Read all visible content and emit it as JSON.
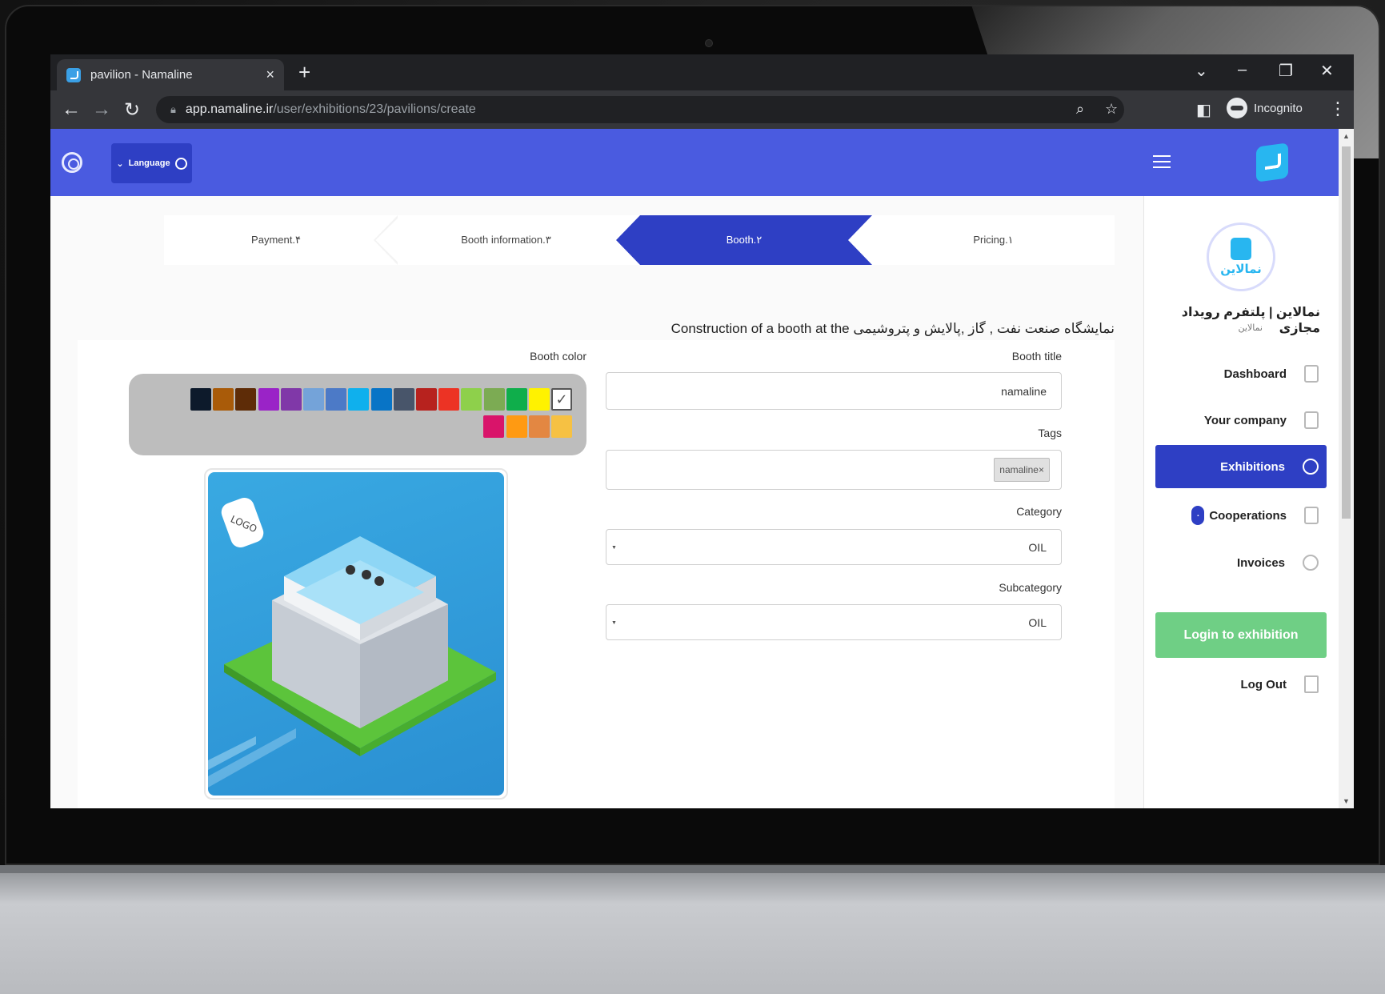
{
  "browser": {
    "tab_title": "pavilion - Namaline",
    "new_tab": "+",
    "close": "×",
    "url_host": "app.namaline.ir",
    "url_path": "/user/exhibitions/23/pavilions/create",
    "incognito_label": "Incognito"
  },
  "topbar": {
    "language_label": "Language"
  },
  "stepper": [
    {
      "label": "Payment.۴",
      "active": false
    },
    {
      "label": "Booth information.۳",
      "active": false
    },
    {
      "label": "Booth.۲",
      "active": true
    },
    {
      "label": "Pricing.۱",
      "active": false
    }
  ],
  "page": {
    "heading": "Construction of a booth at the نمایشگاه صنعت نفت , گاز ,پالایش و پتروشیمی"
  },
  "form": {
    "booth_title_label": "Booth title",
    "booth_title_value": "namaline",
    "tags_label": "Tags",
    "tags": [
      "namaline"
    ],
    "tag_remove": "×",
    "category_label": "Category",
    "category_value": "OIL",
    "subcategory_label": "Subcategory",
    "subcategory_value": "OIL",
    "booth_color_label": "Booth color",
    "selected_color": "#ffffff",
    "colors_row1": [
      "#fff200",
      "#0fae4b",
      "#7cab53",
      "#8ed04b",
      "#ec3324",
      "#b7221e",
      "#48556a",
      "#0874c6",
      "#0fb0ed",
      "#4c7ac7",
      "#74a3d9",
      "#8038a8",
      "#9a23c7",
      "#5e2c07",
      "#a95b09",
      "#0d1a2b"
    ],
    "colors_row2": [
      "#d9146a",
      "#ff9a12",
      "#e38742",
      "#f6c143"
    ]
  },
  "sidebar": {
    "org_name": "نمالاین | پلتفرم رویداد مجازی",
    "org_sub": "نمالاین",
    "avatar_text": "نمالاین",
    "items": [
      {
        "label": "Dashboard",
        "active": false
      },
      {
        "label": "Your company",
        "active": false
      },
      {
        "label": "Exhibitions",
        "active": true
      },
      {
        "label": "Cooperations",
        "active": false,
        "badge": "۰"
      },
      {
        "label": "Invoices",
        "active": false
      },
      {
        "label": "Log Out",
        "active": false
      }
    ],
    "login_button": "Login to exhibition"
  },
  "colors": {
    "primary": "#4a5be0",
    "primary_dark": "#2e3fc4",
    "success": "#6fcf85"
  }
}
